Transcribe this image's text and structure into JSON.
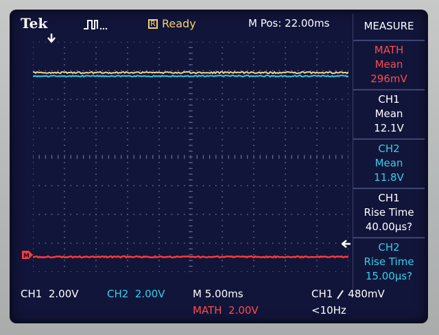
{
  "header": {
    "brand": "Tek",
    "status": "Ready",
    "status_badge": "R",
    "horizontal_position": "M Pos: 22.00ms"
  },
  "colors": {
    "ch1": "#f0d88a",
    "ch2": "#33d0e8",
    "math": "#ff3a3a",
    "text": "#ffffff",
    "screen_bg": "#12153a",
    "grid": "#6a6f96"
  },
  "icons": {
    "acquisition": "pulse-icon",
    "trigger_position": "down-arrow-icon",
    "trigger_level": "left-arrow-icon",
    "trigger_slope": "rising-edge-icon"
  },
  "measure": {
    "title": "MEASURE",
    "items": [
      {
        "source": "MATH",
        "type": "Mean",
        "value": "296mV",
        "color": "#ff4b4b"
      },
      {
        "source": "CH1",
        "type": "Mean",
        "value": "12.1V",
        "color": "#ffffff"
      },
      {
        "source": "CH2",
        "type": "Mean",
        "value": "11.8V",
        "color": "#33d0e8"
      },
      {
        "source": "CH1",
        "type": "Rise Time",
        "value": "40.00µs?",
        "color": "#ffffff"
      },
      {
        "source": "CH2",
        "type": "Rise Time",
        "value": "15.00µs?",
        "color": "#33d0e8"
      }
    ]
  },
  "scale": {
    "ch1_label": "CH1",
    "ch1_value": "2.00V",
    "ch2_label": "CH2",
    "ch2_value": "2.00V",
    "timebase": "M 5.00ms",
    "math_label": "MATH",
    "math_value": "2.00V",
    "trigger_source": "CH1",
    "trigger_level": "480mV",
    "trigger_freq": "<10Hz"
  },
  "markers": {
    "math_ref": "M"
  }
}
